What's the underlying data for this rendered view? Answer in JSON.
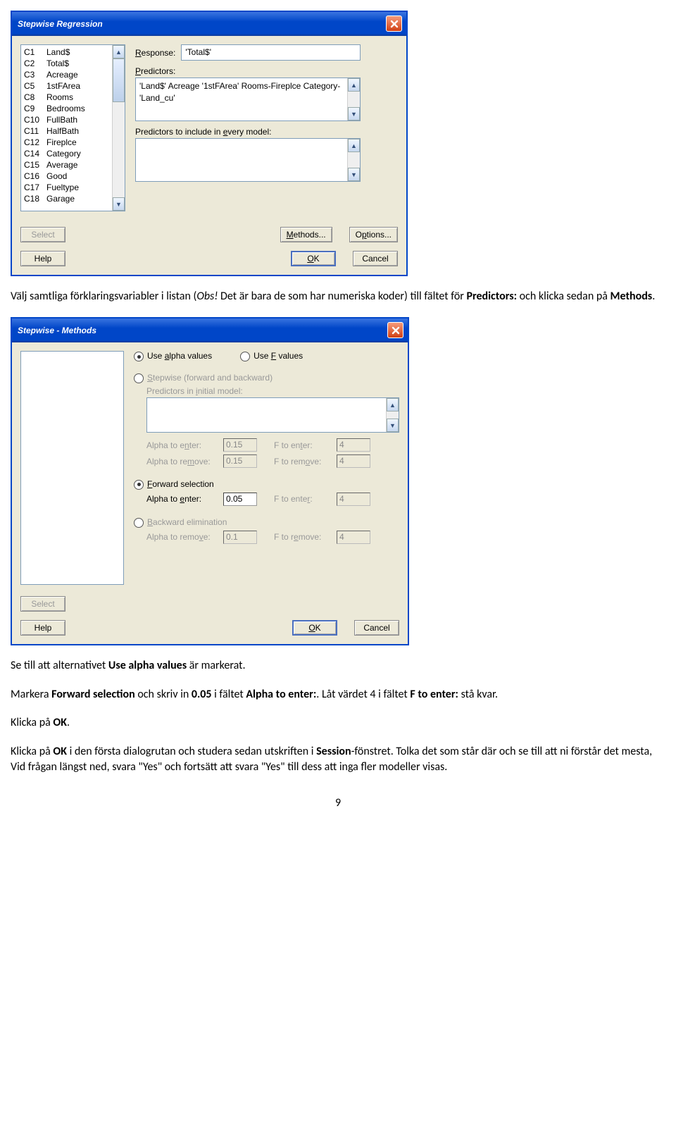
{
  "dialog1": {
    "title": "Stepwise Regression",
    "columns": [
      {
        "id": "C1",
        "name": "Land$"
      },
      {
        "id": "C2",
        "name": "Total$"
      },
      {
        "id": "C3",
        "name": "Acreage"
      },
      {
        "id": "C5",
        "name": "1stFArea"
      },
      {
        "id": "C8",
        "name": "Rooms"
      },
      {
        "id": "C9",
        "name": "Bedrooms"
      },
      {
        "id": "C10",
        "name": "FullBath"
      },
      {
        "id": "C11",
        "name": "HalfBath"
      },
      {
        "id": "C12",
        "name": "Fireplce"
      },
      {
        "id": "C14",
        "name": "Category"
      },
      {
        "id": "C15",
        "name": "Average"
      },
      {
        "id": "C16",
        "name": "Good"
      },
      {
        "id": "C17",
        "name": "Fueltype"
      },
      {
        "id": "C18",
        "name": "Garage"
      }
    ],
    "response_label": "Response:",
    "response_value": "'Total$'",
    "predictors_label": "Predictors:",
    "predictors_value": "'Land$' Acreage '1stFArea' Rooms-Fireplce Category-'Land_cu'",
    "include_label": "Predictors to include in every model:",
    "include_value": "",
    "select": "Select",
    "methods": "Methods...",
    "options": "Options...",
    "help": "Help",
    "ok": "OK",
    "cancel": "Cancel"
  },
  "para1": {
    "a": "Välj samtliga förklaringsvariabler i listan (",
    "b": "Obs!",
    "c": " Det är bara de som har numeriska koder)  till fältet för ",
    "d": "Predictors:",
    "e": " och klicka sedan på ",
    "f": "Methods",
    "g": "."
  },
  "dialog2": {
    "title": "Stepwise - Methods",
    "use_alpha": "Use alpha values",
    "use_f": "Use F values",
    "stepwise": "Stepwise (forward and backward)",
    "pred_initial": "Predictors in initial model:",
    "alpha_enter": "Alpha to enter:",
    "alpha_remove": "Alpha to remove:",
    "f_enter": "F to enter:",
    "f_remove": "F to remove:",
    "forward": "Forward selection",
    "backward": "Backward elimination",
    "v_sw_ae": "0.15",
    "v_sw_ar": "0.15",
    "v_sw_fe": "4",
    "v_sw_fr": "4",
    "v_fw_ae": "0.05",
    "v_fw_fe": "4",
    "v_bw_ar": "0.1",
    "v_bw_fr": "4",
    "select": "Select",
    "help": "Help",
    "ok": "OK",
    "cancel": "Cancel"
  },
  "para2": {
    "a": "Se till att alternativet ",
    "b": "Use alpha values",
    "c": " är markerat."
  },
  "para3": {
    "a": "Markera ",
    "b": "Forward selection",
    "c": " och skriv in ",
    "d": "0.05",
    "e": " i fältet ",
    "f": "Alpha to enter:",
    "g": ". Låt värdet 4 i fältet ",
    "h": "F to enter:",
    "i": " stå kvar."
  },
  "para4": {
    "a": "Klicka på ",
    "b": "OK",
    "c": "."
  },
  "para5": {
    "a": "Klicka på ",
    "b": "OK",
    "c": " i den första dialogrutan och studera sedan utskriften i ",
    "d": "Session",
    "e": "-fönstret. Tolka det som står där och se till att ni förstår det mesta, Vid frågan längst ned, svara \"Yes\" och fortsätt att svara \"Yes\" till dess att inga fler modeller visas."
  },
  "pagenum": "9"
}
